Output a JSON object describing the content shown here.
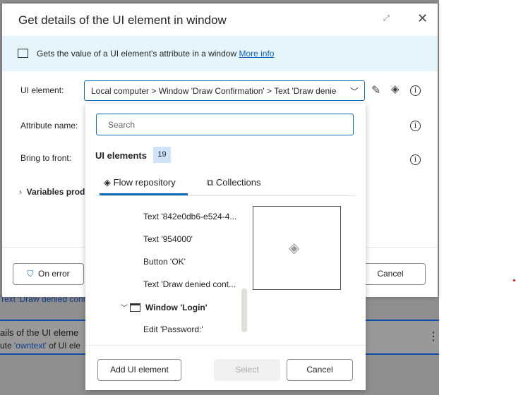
{
  "background": {
    "link_text": "Text 'Draw denied conte",
    "step_title": "ails of the UI eleme",
    "step_desc_prefix": "ute ",
    "step_desc_attr": "'owntext'",
    "step_desc_suffix": " of UI ele"
  },
  "dialog": {
    "title": "Get details of the UI element in window",
    "banner_text": "Gets the value of a UI element's attribute in a window ",
    "banner_link": "More info",
    "fields": {
      "ui_element_label": "UI element:",
      "ui_element_value": "Local computer > Window 'Draw Confirmation' > Text 'Draw denie",
      "attribute_label": "Attribute name:",
      "bring_label": "Bring to front:",
      "variables_label": "Variables prod"
    },
    "footer": {
      "on_error": "On error",
      "cancel": "Cancel"
    }
  },
  "dropdown": {
    "search_placeholder": "Search",
    "heading": "UI elements",
    "count": "19",
    "tabs": [
      {
        "label": "Flow repository"
      },
      {
        "label": "Collections"
      }
    ],
    "items": [
      "Text '842e0db6-e524-4...",
      "Text '954000'",
      "Button 'OK'",
      "Text 'Draw denied cont...",
      "Window 'Login'",
      "Edit 'Password:'"
    ],
    "buttons": {
      "add": "Add UI element",
      "select": "Select",
      "cancel": "Cancel"
    }
  }
}
